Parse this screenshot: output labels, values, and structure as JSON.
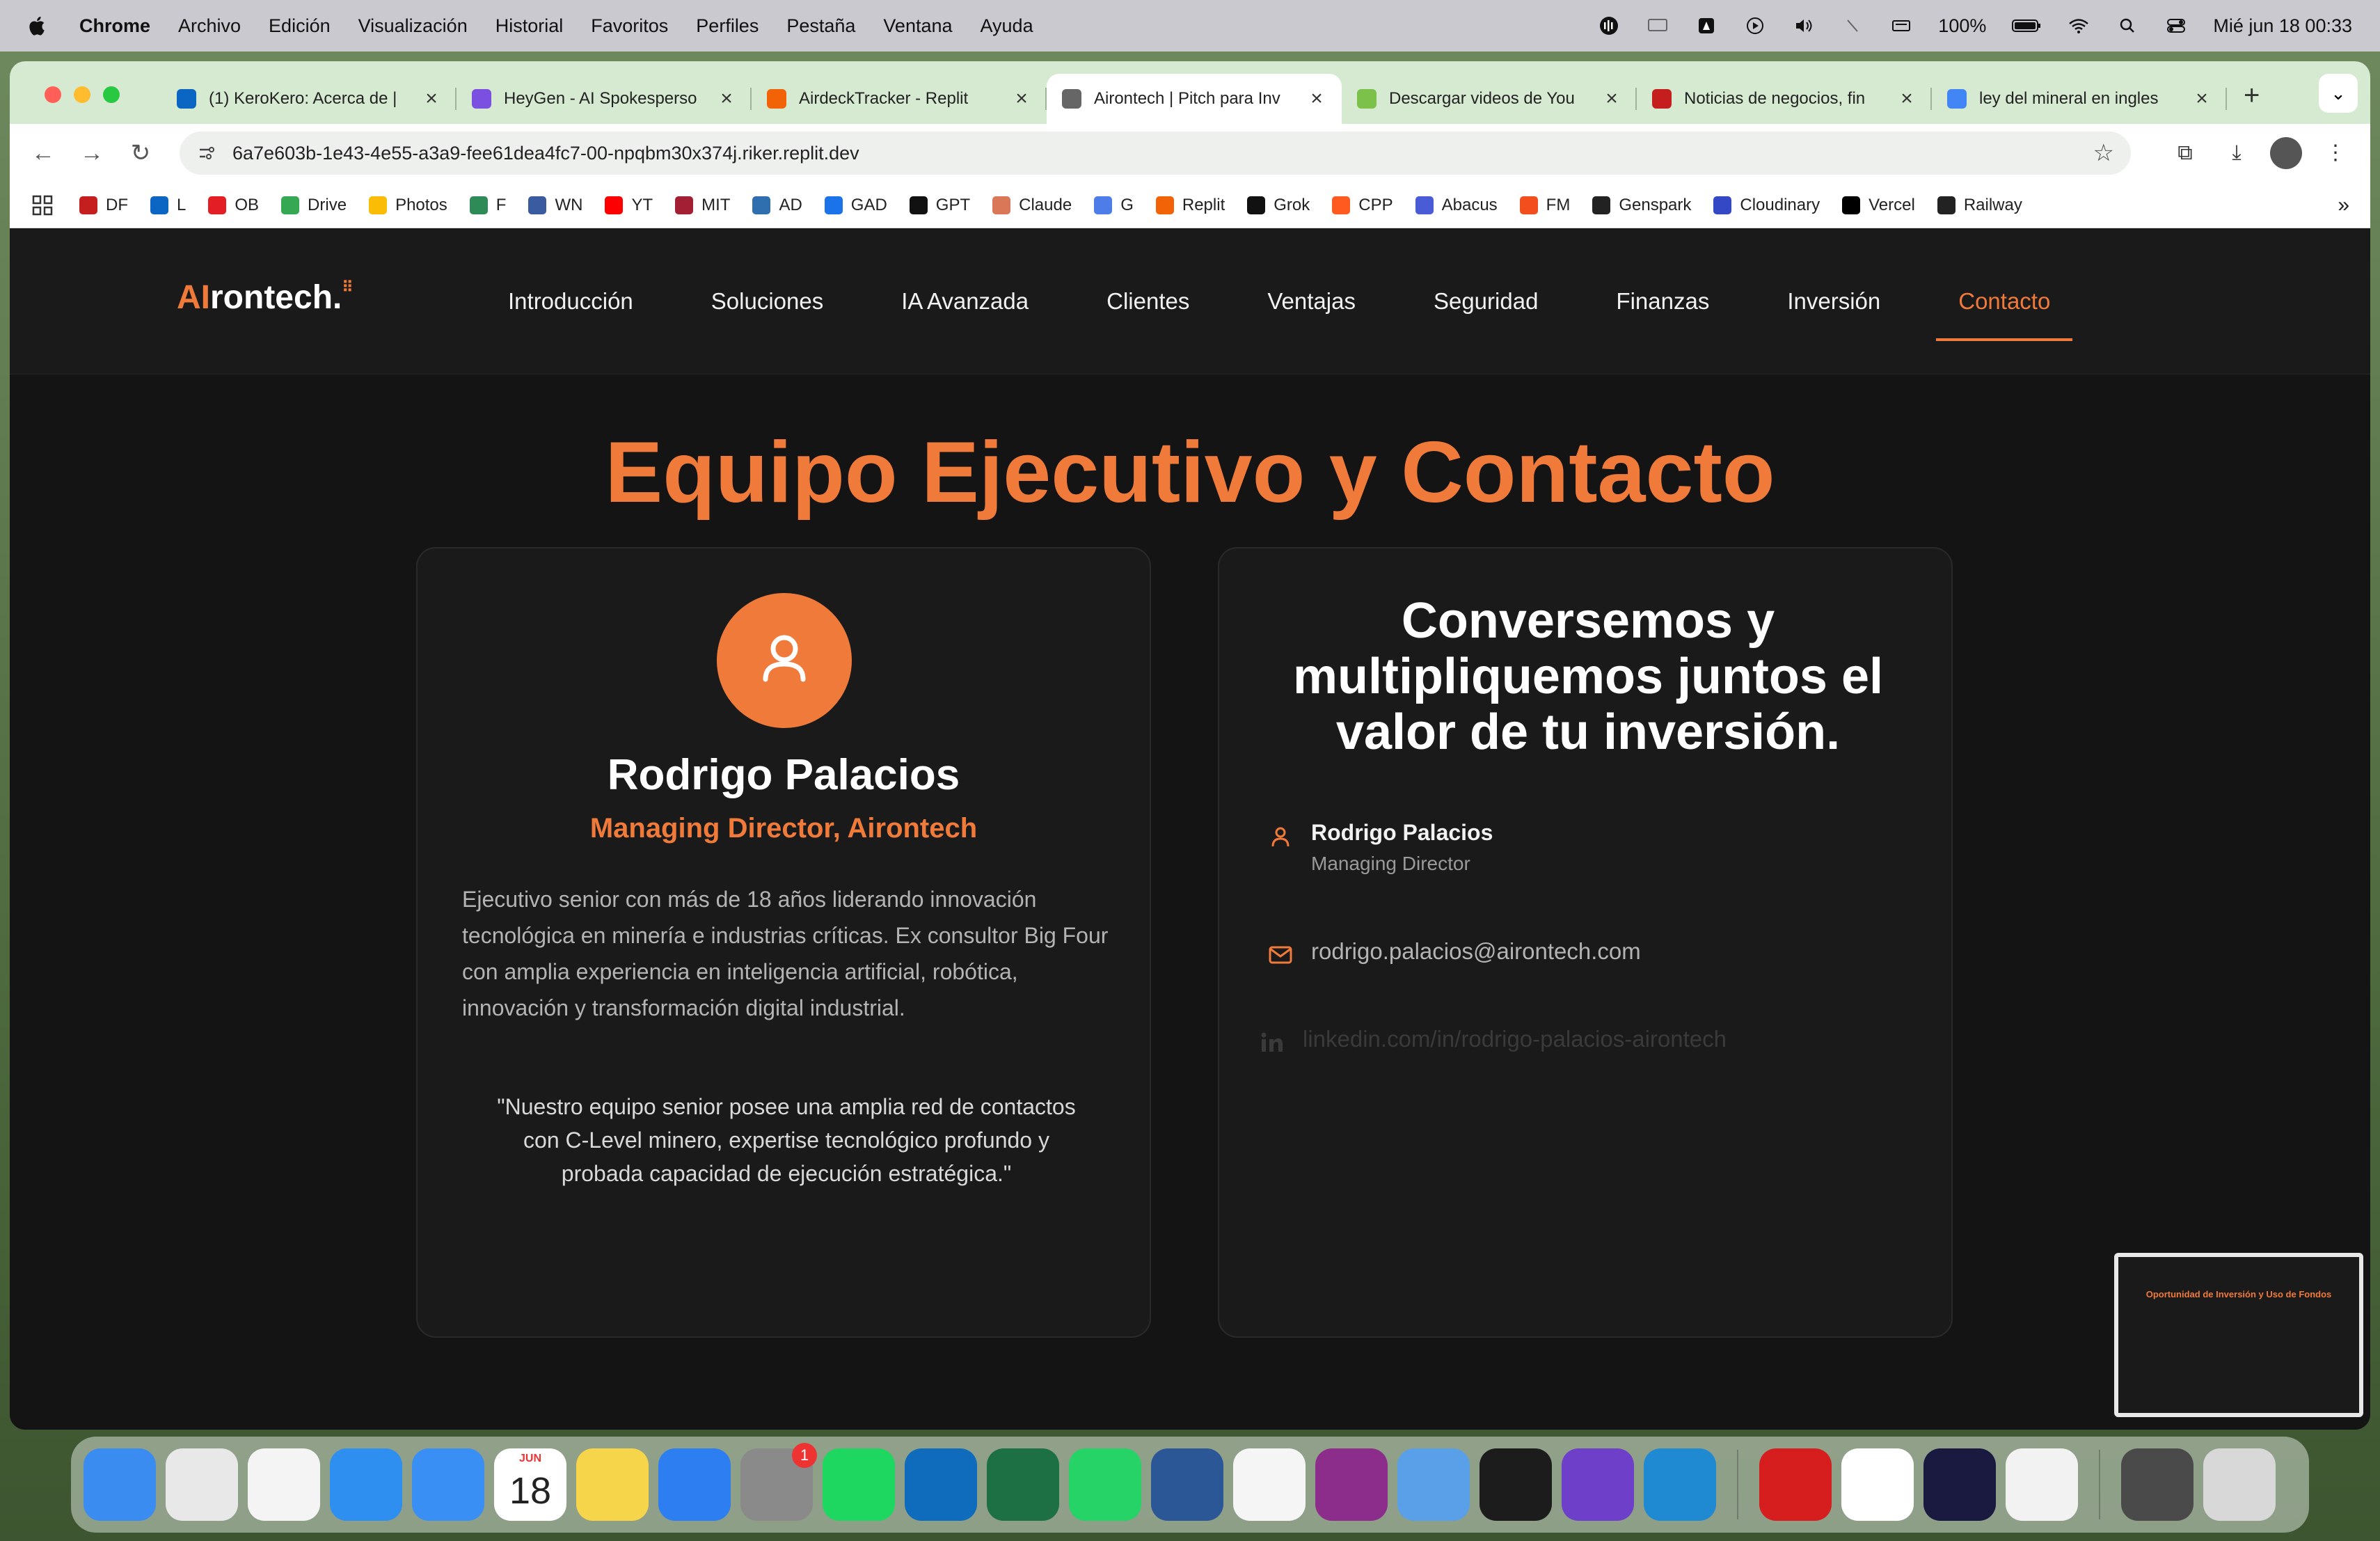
{
  "menubar": {
    "app": "Chrome",
    "items": [
      "Archivo",
      "Edición",
      "Visualización",
      "Historial",
      "Favoritos",
      "Perfiles",
      "Pestaña",
      "Ventana",
      "Ayuda"
    ],
    "battery": "100%",
    "datetime": "Mié jun 18  00:33"
  },
  "tabs": [
    {
      "label": "(1) KeroKero: Acerca de |",
      "color": "#0a66c2"
    },
    {
      "label": "HeyGen - AI Spokesperso",
      "color": "#7b4fe0"
    },
    {
      "label": "AirdeckTracker - Replit",
      "color": "#f26207"
    },
    {
      "label": "Airontech | Pitch para Inv",
      "color": "#666666",
      "active": true
    },
    {
      "label": "Descargar videos de You",
      "color": "#7cc24a"
    },
    {
      "label": "Noticias de negocios, fin",
      "color": "#c41e1e"
    },
    {
      "label": "ley del mineral en ingles",
      "color": "#4285f4"
    }
  ],
  "toolbar": {
    "url": "6a7e603b-1e43-4e55-a3a9-fee61dea4fc7-00-npqbm30x374j.riker.replit.dev"
  },
  "bookmarks": [
    {
      "label": "DF",
      "color": "#c41e1e"
    },
    {
      "label": "L",
      "color": "#0a66c2"
    },
    {
      "label": "OB",
      "color": "#e31e24"
    },
    {
      "label": "Drive",
      "color": "#34a853"
    },
    {
      "label": "Photos",
      "color": "#fbbc05"
    },
    {
      "label": "F",
      "color": "#2e8b57"
    },
    {
      "label": "WN",
      "color": "#3a5ba0"
    },
    {
      "label": "YT",
      "color": "#ff0000"
    },
    {
      "label": "MIT",
      "color": "#a31f34"
    },
    {
      "label": "AD",
      "color": "#2f6fb0"
    },
    {
      "label": "GAD",
      "color": "#1a73e8"
    },
    {
      "label": "GPT",
      "color": "#111111"
    },
    {
      "label": "Claude",
      "color": "#d97757"
    },
    {
      "label": "G",
      "color": "#4e7de9"
    },
    {
      "label": "Replit",
      "color": "#f26207"
    },
    {
      "label": "Grok",
      "color": "#111111"
    },
    {
      "label": "CPP",
      "color": "#ff5a1f"
    },
    {
      "label": "Abacus",
      "color": "#4a5bd6"
    },
    {
      "label": "FM",
      "color": "#f24e1e"
    },
    {
      "label": "Genspark",
      "color": "#222222"
    },
    {
      "label": "Cloudinary",
      "color": "#3448c5"
    },
    {
      "label": "Vercel",
      "color": "#000000"
    },
    {
      "label": "Railway",
      "color": "#222222"
    }
  ],
  "site": {
    "logo_ai": "AI",
    "logo_rest": "rontech.",
    "nav": [
      "Introducción",
      "Soluciones",
      "IA Avanzada",
      "Clientes",
      "Ventajas",
      "Seguridad",
      "Finanzas",
      "Inversión",
      "Contacto"
    ],
    "active_nav": "Contacto",
    "accent": "#f07a3a",
    "section_title": "Equipo Ejecutivo y Contacto",
    "person": {
      "name": "Rodrigo Palacios",
      "role": "Managing Director, Airontech",
      "bio": "Ejecutivo senior con más de 18 años liderando innovación tecnológica en minería e industrias críticas. Ex consultor Big Four con amplia experiencia en inteligencia artificial, robótica, innovación y transformación digital industrial.",
      "quote": "\"Nuestro equipo senior posee una amplia red de contactos con C-Level minero, expertise tecnológico profundo y probada capacidad de ejecución estratégica.\""
    },
    "contact": {
      "cta": "Conversemos y multipliquemos juntos el valor de tu inversión.",
      "name": "Rodrigo Palacios",
      "title": "Managing Director",
      "email": "rodrigo.palacios@airontech.com",
      "linkedin": "linkedin.com/in/rodrigo-palacios-airontech"
    }
  },
  "thumbnail": {
    "title": "Oportunidad de Inversión y Uso de Fondos"
  },
  "dock": {
    "apps": [
      {
        "name": "finder",
        "color": "#3b8cf0"
      },
      {
        "name": "launchpad",
        "color": "#e8e8e8"
      },
      {
        "name": "chrome",
        "color": "#f4f4f4"
      },
      {
        "name": "safari",
        "color": "#2f8ff0"
      },
      {
        "name": "mail",
        "color": "#3a8ff5"
      },
      {
        "name": "calendar",
        "color": "#ffffff"
      },
      {
        "name": "notes",
        "color": "#f7d54a"
      },
      {
        "name": "keynote",
        "color": "#2d7ef0"
      },
      {
        "name": "system-settings",
        "color": "#8a8a8a"
      },
      {
        "name": "spotify",
        "color": "#1ed760"
      },
      {
        "name": "outlook",
        "color": "#0f6cbd"
      },
      {
        "name": "excel",
        "color": "#1d7044"
      },
      {
        "name": "whatsapp",
        "color": "#25d366"
      },
      {
        "name": "word",
        "color": "#2b5797"
      },
      {
        "name": "fantastical",
        "color": "#f5f5f5"
      },
      {
        "name": "obs",
        "color": "#8c2d8c"
      },
      {
        "name": "iphone-mirroring",
        "color": "#5aa0e8"
      },
      {
        "name": "replit",
        "color": "#1c1c1c"
      },
      {
        "name": "github-desktop",
        "color": "#6e40c9"
      },
      {
        "name": "vscode",
        "color": "#1f8ad2"
      },
      {
        "name": "acrobat",
        "color": "#d61e1e"
      },
      {
        "name": "notion",
        "color": "#ffffff"
      },
      {
        "name": "webex",
        "color": "#1a1a40"
      },
      {
        "name": "microsoft-store",
        "color": "#f2f2f2"
      },
      {
        "name": "downloads-folder",
        "color": "#4a4a4a"
      },
      {
        "name": "trash",
        "color": "#d8d8d8"
      }
    ],
    "calendar_month": "JUN",
    "calendar_day": "18",
    "settings_badge": "1"
  }
}
